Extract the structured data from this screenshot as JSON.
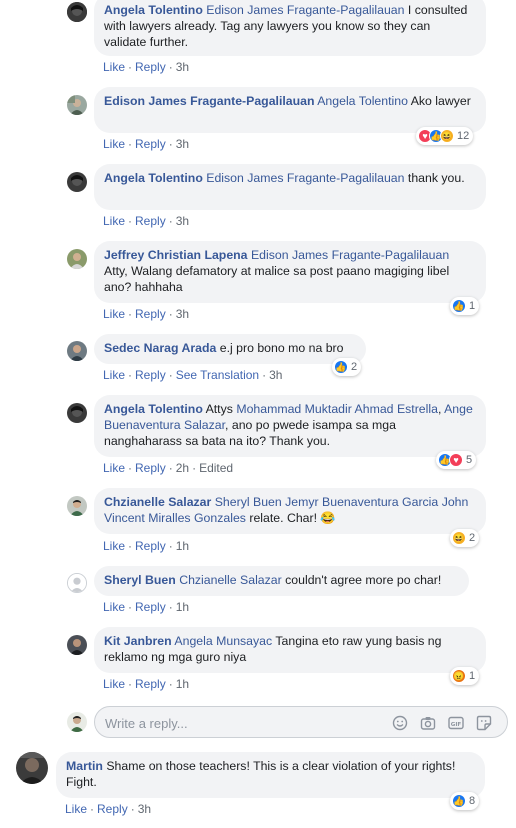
{
  "comments": [
    {
      "author": "Angela Tolentino",
      "mention": "Edison James Fragante-Pagalilauan",
      "text": " I consulted with lawyers already. Tag any lawyers you know so they can validate further.",
      "actions": {
        "like": "Like",
        "reply": "Reply",
        "time": "3h"
      }
    },
    {
      "author": "Edison James Fragante-Pagalilauan",
      "mention": "Angela Tolentino",
      "text": " Ako lawyer",
      "actions": {
        "like": "Like",
        "reply": "Reply",
        "time": "3h"
      },
      "reactions": {
        "count": "12",
        "icons": [
          "love-icon",
          "like-icon",
          "haha-icon"
        ]
      }
    },
    {
      "author": "Angela Tolentino",
      "mention": "Edison James Fragante-Pagalilauan",
      "text": " thank you.",
      "actions": {
        "like": "Like",
        "reply": "Reply",
        "time": "3h"
      }
    },
    {
      "author": "Jeffrey Christian Lapena",
      "mention": "Edison James Fragante-Pagalilauan",
      "text": " Atty, Walang defamatory at malice sa post paano magiging libel ano? hahhaha",
      "actions": {
        "like": "Like",
        "reply": "Reply",
        "time": "3h"
      },
      "reactions": {
        "count": "1",
        "icons": [
          "like-icon"
        ]
      }
    },
    {
      "author": "Sedec Narag Arada",
      "mention": "",
      "text": " e.j pro bono mo na bro",
      "actions": {
        "like": "Like",
        "reply": "Reply",
        "translate": "See Translation",
        "time": "3h"
      },
      "reactions": {
        "count": "2",
        "icons": [
          "like-icon"
        ]
      }
    },
    {
      "author": "Angela Tolentino",
      "pre": " Attys ",
      "mention": "Mohammad Muktadir Ahmad Estrella",
      "mid": ", ",
      "mention2": "Ange Buenaventura Salazar",
      "text": ", ano po pwede isampa sa mga nanghaharass sa bata na ito? Thank you.",
      "actions": {
        "like": "Like",
        "reply": "Reply",
        "time": "2h",
        "edited": "Edited"
      },
      "reactions": {
        "count": "5",
        "icons": [
          "like-icon",
          "love-icon"
        ]
      }
    },
    {
      "author": "Chzianelle Salazar",
      "mention": "Sheryl Buen",
      "mid": " ",
      "mention2": "Jemyr Buenaventura Garcia",
      "mid2": " ",
      "mention3": "John Vincent Miralles Gonzales",
      "text": " relate. Char! 😂",
      "actions": {
        "like": "Like",
        "reply": "Reply",
        "time": "1h"
      },
      "reactions": {
        "count": "2",
        "icons": [
          "haha-icon"
        ]
      }
    },
    {
      "author": "Sheryl Buen",
      "mention": "Chzianelle Salazar",
      "text": " couldn't agree more po char!",
      "actions": {
        "like": "Like",
        "reply": "Reply",
        "time": "1h"
      }
    },
    {
      "author": "Kit Janbren",
      "mention": "Angela Munsayac",
      "text": " Tangina eto raw yung basis ng reklamo ng mga guro niya",
      "actions": {
        "like": "Like",
        "reply": "Reply",
        "time": "1h"
      },
      "reactions": {
        "count": "1",
        "icons": [
          "angry-icon"
        ]
      }
    },
    {
      "author": "Martin",
      "mention": "",
      "text": " Shame on those teachers! This is a clear violation of your rights! Fight.",
      "actions": {
        "like": "Like",
        "reply": "Reply",
        "time": "3h"
      },
      "reactions": {
        "count": "8",
        "icons": [
          "like-icon"
        ]
      }
    }
  ],
  "reply_box": {
    "placeholder": "Write a reply..."
  },
  "colors": {
    "link": "#385898",
    "action": "#4267b2",
    "bubble": "#f2f3f5",
    "like": "#1877f2",
    "love": "#f33e58",
    "haha": "#f7b125",
    "angry": "#e9710f"
  }
}
